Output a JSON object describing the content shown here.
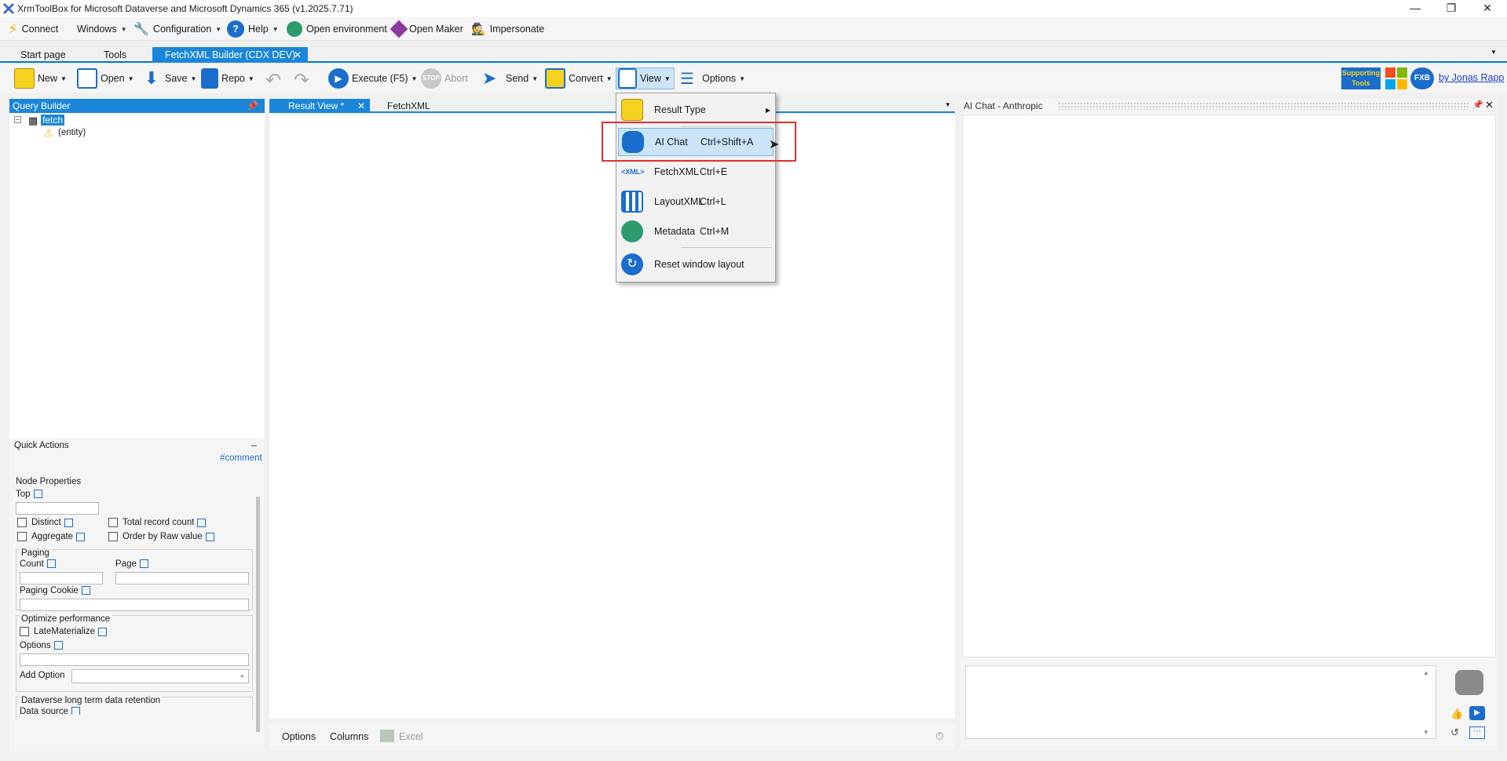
{
  "window": {
    "title": "XrmToolBox for Microsoft Dataverse and Microsoft Dynamics 365 (v1.2025.7.71)"
  },
  "menubar": {
    "connect": "Connect",
    "windows": "Windows",
    "configuration": "Configuration",
    "help": "Help",
    "open_environment": "Open environment",
    "open_maker": "Open Maker",
    "impersonate": "Impersonate"
  },
  "tabs": {
    "start": "Start page",
    "tools": "Tools",
    "active": "FetchXML Builder (CDX DEV)"
  },
  "toolbar": {
    "new": "New",
    "open": "Open",
    "save": "Save",
    "repo": "Repo",
    "execute": "Execute (F5)",
    "abort": "Abort",
    "send": "Send",
    "convert": "Convert",
    "view": "View",
    "options": "Options",
    "stop": "STOP",
    "supporting": "Supporting Tools",
    "by": "by Jonas Rapp",
    "fxb": "FXB"
  },
  "query_builder": {
    "title": "Query Builder",
    "tree_root": "fetch",
    "tree_child": "(entity)"
  },
  "quick_actions": {
    "title": "Quick Actions",
    "comment": "#comment"
  },
  "node_properties": {
    "title": "Node Properties",
    "top": "Top",
    "distinct": "Distinct",
    "total_record_count": "Total record count",
    "aggregate": "Aggregate",
    "order_by_raw": "Order by Raw value",
    "paging": "Paging",
    "count": "Count",
    "page": "Page",
    "paging_cookie": "Paging Cookie",
    "optimize": "Optimize performance",
    "late_materialize": "LateMaterialize",
    "options": "Options",
    "add_option": "Add Option",
    "retention": "Dataverse long term data retention",
    "data_source": "Data source"
  },
  "center": {
    "tab_result": "Result View *",
    "tab_fetchxml": "FetchXML",
    "bottom_options": "Options",
    "bottom_columns": "Columns",
    "bottom_excel": "Excel"
  },
  "right": {
    "title": "AI Chat - Anthropic"
  },
  "view_menu": {
    "items": [
      {
        "label": "Result Type",
        "shortcut": "",
        "icon": "clipboard-icon"
      },
      {
        "label": "AI Chat",
        "shortcut": "Ctrl+Shift+A",
        "icon": "robot-icon"
      },
      {
        "label": "FetchXML",
        "shortcut": "Ctrl+E",
        "icon": "xml-icon"
      },
      {
        "label": "LayoutXML",
        "shortcut": "Ctrl+L",
        "icon": "columns-icon"
      },
      {
        "label": "Metadata",
        "shortcut": "Ctrl+M",
        "icon": "metadata-icon"
      },
      {
        "label": "Reset window layout",
        "shortcut": "",
        "icon": "refresh-icon"
      }
    ]
  },
  "colors": {
    "accent": "#1b86d9",
    "highlight": "#cce4f7",
    "annotation": "#e03030"
  }
}
